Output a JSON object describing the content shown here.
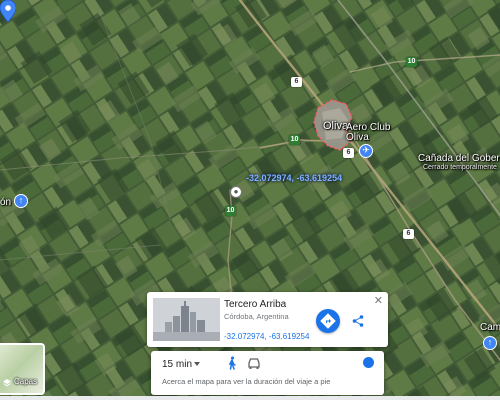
{
  "map": {
    "labels": {
      "oliva": "Oliva",
      "aero_club": "Aero Club\nOliva",
      "canada": "Cañada del Gobernad...",
      "canada_sub": "Cerrado temporalmente",
      "left_town": "ón",
      "right_edge": "Camp"
    },
    "coord_overlay": "-32.072974, -63.619254",
    "road_shields": {
      "r10_top": "10",
      "r6_top": "6",
      "r10_mid": "10",
      "r6_mid": "6",
      "r10_left": "10",
      "r6_low": "6"
    }
  },
  "place_card": {
    "title": "Tercero Arriba",
    "subtitle": "Córdoba, Argentina",
    "coordinates": "-32.072974, -63.619254",
    "close_icon": "close-icon",
    "directions_icon": "directions-icon",
    "share_icon": "share-icon"
  },
  "travel": {
    "time": "15 min",
    "hint": "Acerca el mapa para ver la duración del viaje a pie",
    "modes": [
      "walk-icon",
      "car-icon"
    ]
  },
  "layers": {
    "label": "Capas"
  },
  "colors": {
    "accent": "#1a73e8",
    "town_outline": "#ff5b6b",
    "pin": "#4285f4"
  }
}
